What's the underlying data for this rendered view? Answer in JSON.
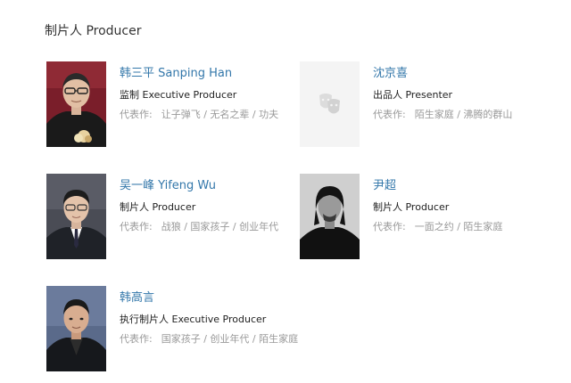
{
  "section": {
    "title": "制片人 Producer"
  },
  "people": [
    {
      "name": "韩三平 Sanping Han",
      "role": "监制 Executive Producer",
      "works_label": "代表作:",
      "works": "让子弹飞 / 无名之辈 / 功夫",
      "photo_icon": "person-photo"
    },
    {
      "name": "沈京喜",
      "role": "出品人 Presenter",
      "works_label": "代表作:",
      "works": "陌生家庭 / 沸腾的群山",
      "photo_icon": "theater-masks-icon"
    },
    {
      "name": "吴一峰 Yifeng Wu",
      "role": "制片人 Producer",
      "works_label": "代表作:",
      "works": "战狼 / 国家孩子 / 创业年代",
      "photo_icon": "person-photo"
    },
    {
      "name": "尹超",
      "role": "制片人 Producer",
      "works_label": "代表作:",
      "works": "一面之约 / 陌生家庭",
      "photo_icon": "person-photo"
    },
    {
      "name": "韩高言",
      "role": "执行制片人 Executive Producer",
      "works_label": "代表作:",
      "works": "国家孩子 / 创业年代 / 陌生家庭",
      "photo_icon": "person-photo"
    }
  ],
  "colors": {
    "name_link": "#3377aa",
    "works_text": "#999999",
    "placeholder_bg": "#f4f4f4"
  }
}
